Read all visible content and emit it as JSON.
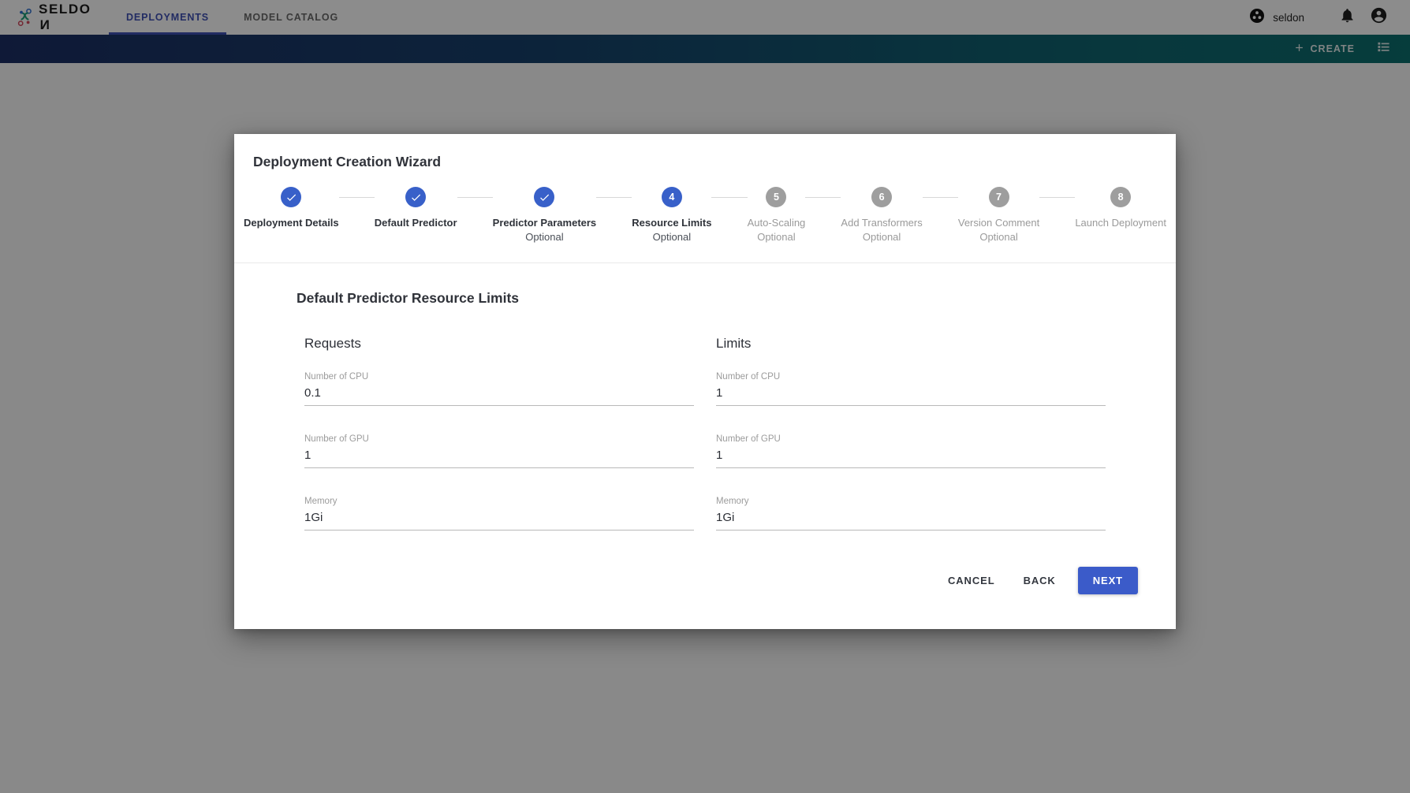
{
  "appbar": {
    "brand": {
      "name_left": "SELDO",
      "name_reversed": "N",
      "logo_icon": "seldon-logo-icon"
    },
    "tabs": [
      {
        "label": "DEPLOYMENTS",
        "active": true
      },
      {
        "label": "MODEL CATALOG",
        "active": false
      }
    ],
    "namespace": {
      "label": "seldon",
      "icon": "namespace-cluster-icon"
    },
    "notifications_icon": "bell-icon",
    "account_icon": "account-circle-icon"
  },
  "subbar": {
    "create_label": "CREATE",
    "create_icon": "plus-icon",
    "list_view_icon": "list-view-icon",
    "gradient_start": "#1c2f64",
    "gradient_end": "#0c6f6e"
  },
  "modal": {
    "title": "Deployment Creation Wizard",
    "stepper": [
      {
        "num": "1",
        "label": "Deployment Details",
        "sub": "",
        "state": "done"
      },
      {
        "num": "2",
        "label": "Default Predictor",
        "sub": "",
        "state": "done"
      },
      {
        "num": "3",
        "label": "Predictor Parameters",
        "sub": "Optional",
        "state": "done"
      },
      {
        "num": "4",
        "label": "Resource Limits",
        "sub": "Optional",
        "state": "active"
      },
      {
        "num": "5",
        "label": "Auto-Scaling",
        "sub": "Optional",
        "state": "todo"
      },
      {
        "num": "6",
        "label": "Add Transformers",
        "sub": "Optional",
        "state": "todo"
      },
      {
        "num": "7",
        "label": "Version Comment",
        "sub": "Optional",
        "state": "todo"
      },
      {
        "num": "8",
        "label": "Launch Deployment",
        "sub": "",
        "state": "todo"
      }
    ],
    "section_title": "Default Predictor Resource Limits",
    "columns": [
      {
        "heading": "Requests",
        "fields": [
          {
            "label": "Number of CPU",
            "value": "0.1",
            "placeholder": ""
          },
          {
            "label": "Number of GPU",
            "value": "1",
            "placeholder": ""
          },
          {
            "label": "Memory",
            "value": "1Gi",
            "placeholder": ""
          }
        ]
      },
      {
        "heading": "Limits",
        "fields": [
          {
            "label": "Number of CPU",
            "value": "1",
            "placeholder": ""
          },
          {
            "label": "Number of GPU",
            "value": "1",
            "placeholder": ""
          },
          {
            "label": "Memory",
            "value": "1Gi",
            "placeholder": ""
          }
        ]
      }
    ],
    "actions": {
      "cancel_label": "CANCEL",
      "back_label": "BACK",
      "next_label": "NEXT",
      "next_color": "#3b5bc9"
    }
  }
}
